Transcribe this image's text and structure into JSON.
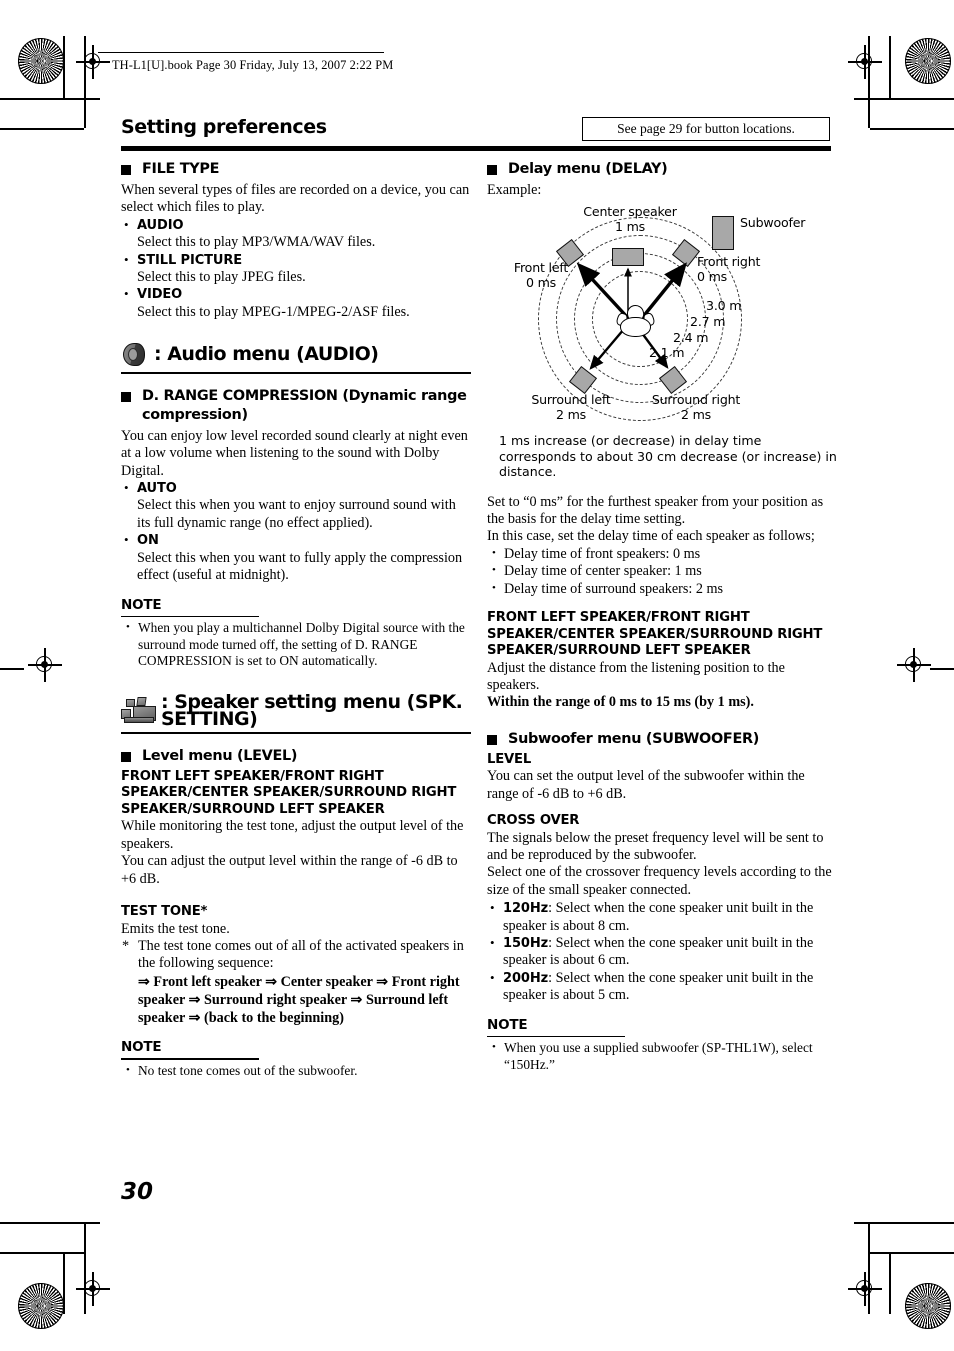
{
  "printmark": {
    "file_stamp": "TH-L1[U].book  Page 30  Friday, July 13, 2007  2:22 PM"
  },
  "header": {
    "title": "Setting preferences",
    "see_page_note": "See page 29 for button locations."
  },
  "left_column": {
    "file_type": {
      "heading": "FILE TYPE",
      "intro": "When several types of files are recorded on a device, you can select which files to play.",
      "items": [
        {
          "label": "AUDIO",
          "desc": "Select this to play MP3/WMA/WAV files."
        },
        {
          "label": "STILL PICTURE",
          "desc": "Select this to play JPEG files."
        },
        {
          "label": "VIDEO",
          "desc": "Select this to play MPEG-1/MPEG-2/ASF files."
        }
      ]
    },
    "audio_menu": {
      "icon": "speaker-cone-icon",
      "title": ": Audio menu (AUDIO)",
      "drc": {
        "heading": "D. RANGE COMPRESSION (Dynamic range compression)",
        "intro": "You can enjoy low level recorded sound clearly at night even at a low volume when listening to the sound with Dolby Digital.",
        "items": [
          {
            "label": "AUTO",
            "desc": "Select this when you want to enjoy surround sound with its full dynamic range (no effect applied)."
          },
          {
            "label": "ON",
            "desc": "Select this when you want to fully apply the compression effect (useful at midnight)."
          }
        ],
        "note_heading": "NOTE",
        "notes": [
          "When you play a multichannel Dolby Digital source with the surround mode turned off, the setting of D. RANGE COMPRESSION is set to ON automatically."
        ]
      }
    },
    "spk_menu": {
      "icon": "multi-speaker-icon",
      "title": ": Speaker setting menu (SPK. SETTING)",
      "level_menu": {
        "heading": "Level menu (LEVEL)",
        "speakers_caps": "FRONT LEFT SPEAKER/FRONT RIGHT SPEAKER/CENTER SPEAKER/SURROUND RIGHT SPEAKER/SURROUND LEFT SPEAKER",
        "body1": "While monitoring the test tone, adjust the output level of the speakers.",
        "body2": "You can adjust the output level within the range of -6 dB to +6 dB.",
        "test_tone_heading": "TEST TONE*",
        "test_tone_body": "Emits the test tone.",
        "footnote": "The test tone comes out of all of the activated speakers in the following sequence:",
        "sequence": "⇒ Front left speaker ⇒ Center speaker ⇒ Front right speaker ⇒ Surround right speaker ⇒ Surround left speaker ⇒ (back to the beginning)",
        "note_heading": "NOTE",
        "notes": [
          "No test tone comes out of the subwoofer."
        ]
      }
    }
  },
  "right_column": {
    "delay_menu": {
      "heading": "Delay menu (DELAY)",
      "example_label": "Example:",
      "diagram": {
        "labels": {
          "center_speaker": "Center speaker",
          "center_speaker_delay": "1 ms",
          "subwoofer": "Subwoofer",
          "front_left": "Front left",
          "front_left_delay": "0 ms",
          "front_right": "Front right",
          "front_right_delay": "0 ms",
          "surround_left": "Surround left",
          "surround_left_delay": "2 ms",
          "surround_right": "Surround right",
          "surround_right_delay": "2 ms"
        },
        "distance_rings": [
          "3.0 m",
          "2.7 m",
          "2.4 m",
          "2.1 m"
        ]
      },
      "diagram_caption": "1 ms increase (or decrease) in delay time corresponds to about 30 cm decrease (or increase) in distance.",
      "body1": "Set to “0 ms” for the furthest speaker from your position as the basis for the delay time setting.",
      "body2": "In this case, set the delay time of each speaker as follows;",
      "delay_items": [
        "Delay time of front speakers: 0 ms",
        "Delay time of center speaker: 1 ms",
        "Delay time of surround speakers: 2 ms"
      ],
      "speakers_caps": "FRONT LEFT SPEAKER/FRONT RIGHT SPEAKER/CENTER SPEAKER/SURROUND RIGHT SPEAKER/SURROUND LEFT SPEAKER",
      "adjust_body": "Adjust the distance from the listening position to the speakers.",
      "range_body": "Within the range of 0 ms to 15 ms (by 1 ms)."
    },
    "subwoofer_menu": {
      "heading": "Subwoofer menu (SUBWOOFER)",
      "level_heading": "LEVEL",
      "level_body": "You can set the output level of the subwoofer within the range of -6 dB to +6 dB.",
      "cross_over_heading": "CROSS OVER",
      "cross_over_body1": "The signals below the preset frequency level will be sent to and be reproduced by the subwoofer.",
      "cross_over_body2": "Select one of the crossover frequency levels according to the size of the small speaker connected.",
      "items": [
        {
          "label": "120Hz",
          "desc": ": Select when the cone speaker unit built in the speaker is about 8 cm."
        },
        {
          "label": "150Hz",
          "desc": ": Select when the cone speaker unit built in the speaker is about 6 cm."
        },
        {
          "label": "200Hz",
          "desc": ": Select when the cone speaker unit built in the speaker is about 5 cm."
        }
      ],
      "note_heading": "NOTE",
      "notes": [
        "When you use a supplied subwoofer (SP-THL1W), select “150Hz.”"
      ]
    }
  },
  "footer": {
    "page_number": "30"
  }
}
